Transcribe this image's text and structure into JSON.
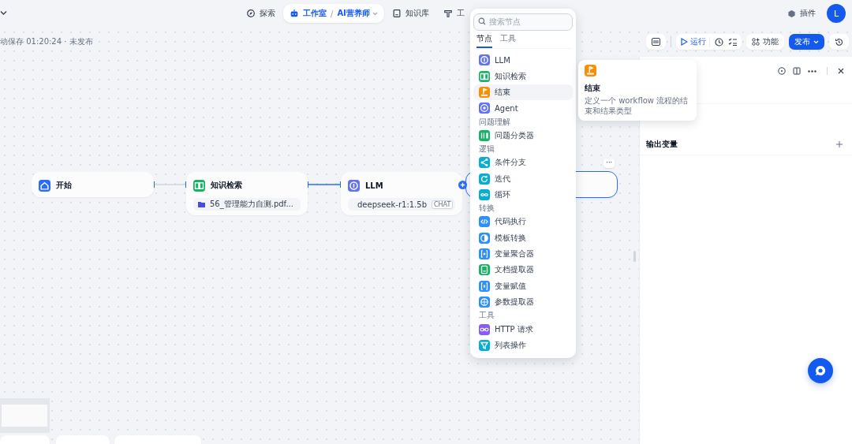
{
  "top_nav": {
    "items": [
      {
        "label": "探索",
        "selected": false,
        "kind": "explore"
      },
      {
        "label": "工作室",
        "selected": true,
        "kind": "studio",
        "separator": "/",
        "app": "AI营养师"
      },
      {
        "label": "知识库",
        "selected": false,
        "kind": "knowledge"
      },
      {
        "label": "工",
        "selected": false,
        "kind": "tools"
      }
    ],
    "plugins": "插件",
    "avatar": "L"
  },
  "status": "动保存 01:20:24 · 未发布",
  "toolbar": {
    "run": "运行",
    "features": "功能",
    "publish": "发布"
  },
  "nodes": [
    {
      "kind": "start",
      "title": "开始",
      "selected": false
    },
    {
      "kind": "knowledge",
      "title": "知识检索",
      "dataset": "56_管理能力自测.pdf...",
      "selected": false
    },
    {
      "kind": "llm",
      "title": "LLM",
      "model": "deepseek-r1:1.5b",
      "badge": "CHAT",
      "selected": false
    },
    {
      "kind": "blank",
      "selected": true,
      "more": "···"
    }
  ],
  "picker": {
    "placeholder": "搜索节点",
    "tabs": [
      {
        "label": "节点",
        "selected": true
      },
      {
        "label": "工具",
        "selected": false
      }
    ],
    "groups": [
      {
        "items": [
          {
            "label": "LLM",
            "kind": "llm",
            "color": "#6172f3",
            "selected": false
          },
          {
            "label": "知识检索",
            "kind": "knowledge",
            "color": "#16b364",
            "selected": false
          },
          {
            "label": "结束",
            "kind": "end",
            "color": "#f79009",
            "selected": true
          },
          {
            "label": "Agent",
            "kind": "agent",
            "color": "#6172f3",
            "selected": false
          }
        ]
      },
      {
        "title": "问题理解",
        "items": [
          {
            "label": "问题分类器",
            "kind": "classifier",
            "color": "#16b364",
            "selected": false
          }
        ]
      },
      {
        "title": "逻辑",
        "items": [
          {
            "label": "条件分支",
            "kind": "if-else",
            "color": "#06aed4",
            "selected": false
          },
          {
            "label": "迭代",
            "kind": "iteration",
            "color": "#06aed4",
            "selected": false
          },
          {
            "label": "循环",
            "kind": "loop",
            "color": "#06aed4",
            "selected": false
          }
        ]
      },
      {
        "title": "转换",
        "items": [
          {
            "label": "代码执行",
            "kind": "code",
            "color": "#2e90fa",
            "selected": false
          },
          {
            "label": "模板转换",
            "kind": "template",
            "color": "#2e90fa",
            "selected": false
          },
          {
            "label": "变量聚合器",
            "kind": "aggregator",
            "color": "#2e90fa",
            "selected": false
          },
          {
            "label": "文档提取器",
            "kind": "doc-extractor",
            "color": "#16b364",
            "selected": false
          },
          {
            "label": "变量赋值",
            "kind": "assigner",
            "color": "#2e90fa",
            "selected": false
          },
          {
            "label": "参数提取器",
            "kind": "parameter",
            "color": "#2e90fa",
            "selected": false
          }
        ]
      },
      {
        "title": "工具",
        "items": [
          {
            "label": "HTTP 请求",
            "kind": "http",
            "color": "#875bf7",
            "selected": false
          },
          {
            "label": "列表操作",
            "kind": "list",
            "color": "#06aed4",
            "selected": false
          }
        ]
      }
    ]
  },
  "tooltip": {
    "kind": "end",
    "color": "#f79009",
    "title": "结束",
    "description": "定义一个 workflow 流程的结束和结果类型"
  },
  "panel": {
    "section": "输出变量"
  }
}
